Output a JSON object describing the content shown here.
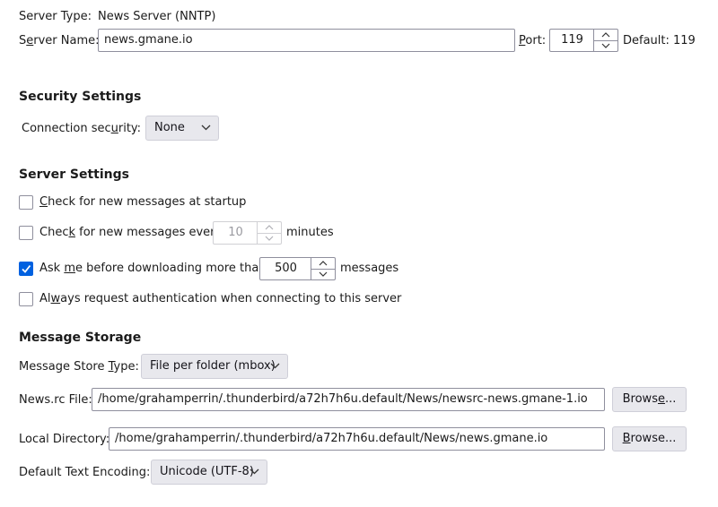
{
  "server": {
    "type_label": "Server Type:",
    "type_value": "News Server (NNTP)",
    "name_label_pre": "S",
    "name_label_ul": "e",
    "name_label_post": "rver Name:",
    "name_value": "news.gmane.io",
    "port_label_ul": "P",
    "port_label_post": "ort:",
    "port_value": "119",
    "default_label": "Default: 119"
  },
  "security": {
    "heading": "Security Settings",
    "conn_label_pre": "Connection sec",
    "conn_label_ul": "u",
    "conn_label_post": "rity:",
    "conn_value": "None"
  },
  "server_settings": {
    "heading": "Server Settings",
    "startup": {
      "pre": "",
      "ul": "C",
      "post": "heck for new messages at startup",
      "checked": false
    },
    "every": {
      "pre": "Chec",
      "ul": "k",
      "post": " for new messages every",
      "value": "10",
      "suffix": "minutes",
      "checked": false
    },
    "ask": {
      "pre": "Ask ",
      "ul": "m",
      "post": "e before downloading more than",
      "value": "500",
      "suffix": "messages",
      "checked": true
    },
    "auth": {
      "pre": "Al",
      "ul": "w",
      "post": "ays request authentication when connecting to this server",
      "checked": false
    }
  },
  "storage": {
    "heading": "Message Storage",
    "store_label_pre": "Message Store ",
    "store_label_ul": "T",
    "store_label_post": "ype:",
    "store_value": "File per folder (mbox)",
    "newsrc_label": "News.rc File:",
    "newsrc_value": "/home/grahamperrin/.thunderbird/a72h7h6u.default/News/newsrc-news.gmane-1.io",
    "browse1_pre": "Brows",
    "browse1_ul": "e",
    "browse1_post": "...",
    "local_label": "Local Directory:",
    "local_value": "/home/grahamperrin/.thunderbird/a72h7h6u.default/News/news.gmane.io",
    "browse2_ul": "B",
    "browse2_post": "rowse...",
    "encoding_label": "Default Text Encoding:",
    "encoding_value": "Unicode (UTF-8)"
  },
  "colors": {
    "accent": "#0061e0",
    "button_bg": "#e8e8ed",
    "border": "#8f8f9d"
  }
}
